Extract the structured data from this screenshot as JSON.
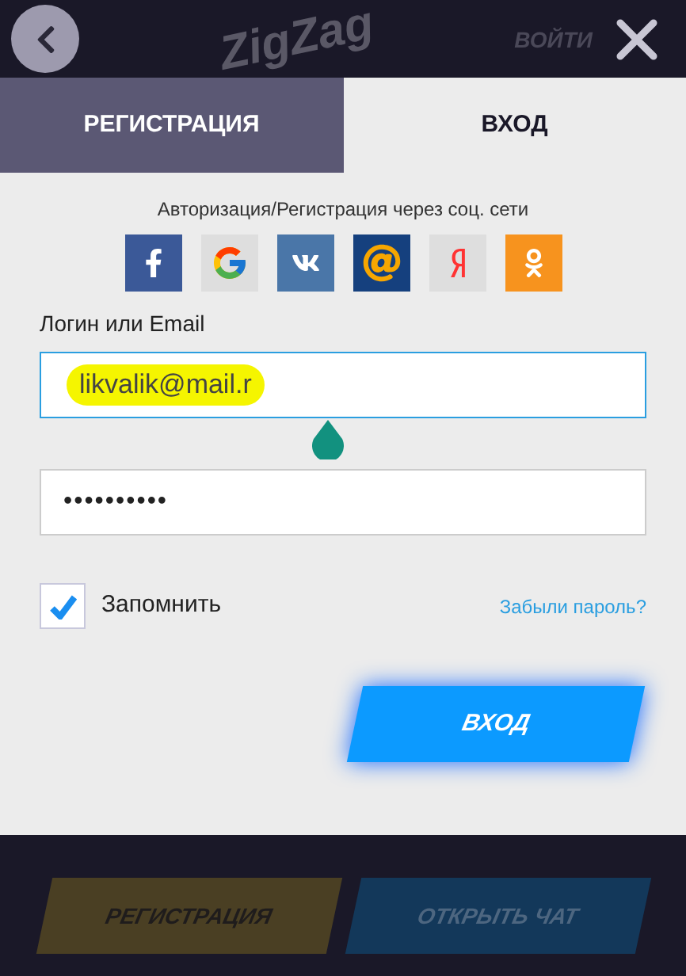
{
  "header": {
    "logo": "ZigZag",
    "login_link": "ВОЙТИ"
  },
  "tabs": [
    {
      "label": "РЕГИСТРАЦИЯ",
      "selected": false
    },
    {
      "label": "ВХОД",
      "selected": true
    }
  ],
  "social": {
    "caption": "Авторизация/Регистрация через соц. сети",
    "networks": [
      {
        "kind": "facebook"
      },
      {
        "kind": "google"
      },
      {
        "kind": "vk"
      },
      {
        "kind": "mail"
      },
      {
        "kind": "yandex"
      },
      {
        "kind": "ok"
      }
    ]
  },
  "login_field": {
    "label": "Логин или Email",
    "value": "likvalik@mail.r",
    "focused": true
  },
  "password_field": {
    "value": "••••••••••"
  },
  "remember": {
    "label": "Запомнить",
    "checked": true
  },
  "forgot_link": "Забыли пароль?",
  "submit": "ВХОД",
  "footer": {
    "buttons": [
      {
        "label": "РЕГИСТРАЦИЯ",
        "kind": "yellow"
      },
      {
        "label": "ОТКРЫТЬ ЧАТ",
        "kind": "blue"
      }
    ]
  }
}
